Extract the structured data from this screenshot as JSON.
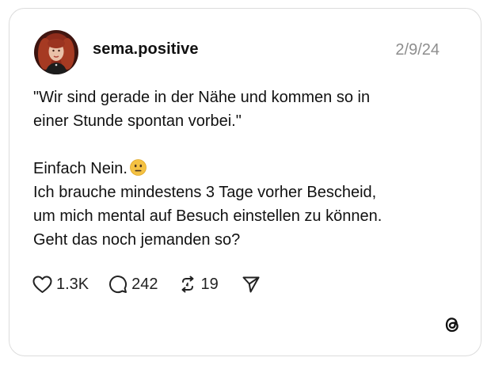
{
  "post": {
    "username": "sema.positive",
    "date": "2/9/24",
    "lines": [
      "\"Wir sind gerade in der Nähe und kommen so in",
      "einer Stunde spontan vorbei.\"",
      "Einfach Nein.",
      "Ich brauche mindestens 3 Tage vorher Bescheid,",
      "um mich mental auf Besuch einstellen zu können.",
      "Geht das noch jemanden so?"
    ],
    "emoji": "neutral-face-emoji"
  },
  "actions": {
    "likes": "1.3K",
    "replies": "242",
    "reposts": "19",
    "like_icon": "heart-icon",
    "reply_icon": "comment-bubble-icon",
    "repost_icon": "repost-icon",
    "share_icon": "send-icon"
  },
  "branding": {
    "logo": "threads-logo"
  },
  "colors": {
    "text": "#111111",
    "muted": "#8e8e8e",
    "border": "#dcdcdc",
    "emoji": "#f5c242"
  }
}
